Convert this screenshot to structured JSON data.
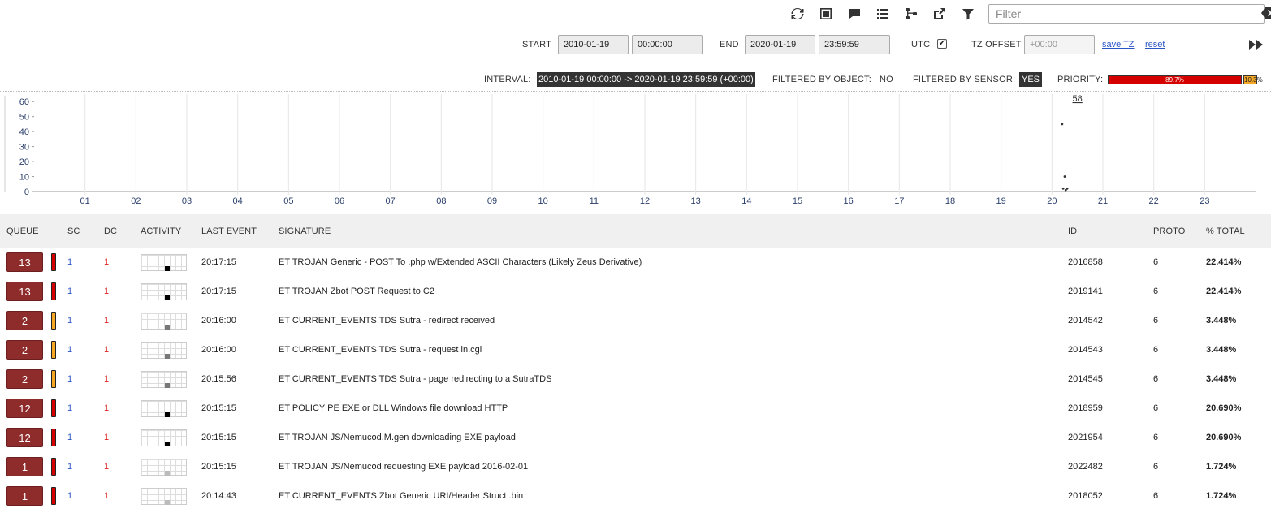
{
  "toolbar": {
    "icons": [
      "refresh-icon",
      "fullscreen-icon",
      "comment-icon",
      "list-icon",
      "tree-icon",
      "external-link-icon",
      "funnel-icon"
    ],
    "filter_placeholder": "Filter"
  },
  "timebar": {
    "start_label": "START",
    "start_date": "2010-01-19",
    "start_time": "00:00:00",
    "end_label": "END",
    "end_date": "2020-01-19",
    "end_time": "23:59:59",
    "utc_label": "UTC",
    "utc_checked": "✔",
    "tz_label": "TZ OFFSET",
    "tz_placeholder": "+00:00",
    "save_tz": "save TZ",
    "reset": "reset"
  },
  "status": {
    "interval_label": "INTERVAL:",
    "interval_value": "2010-01-19 00:00:00 -> 2020-01-19 23:59:59 (+00:00)",
    "filtered_object_label": "FILTERED BY OBJECT:",
    "filtered_object_value": "NO",
    "filtered_sensor_label": "FILTERED BY SENSOR:",
    "filtered_sensor_value": "YES",
    "priority_label": "PRIORITY:",
    "priority_high": "89.7%",
    "priority_med": "10.3%",
    "priority_high_fraction": 0.897,
    "priority_high_color": "#d40000",
    "priority_med_color": "#f5a623"
  },
  "chart_data": {
    "type": "scatter",
    "peak_label": "58",
    "y_ticks": [
      "60",
      "50",
      "40",
      "30",
      "20",
      "10",
      "0"
    ],
    "ylim": [
      0,
      65
    ],
    "x_ticks": [
      "01",
      "02",
      "03",
      "04",
      "05",
      "06",
      "07",
      "08",
      "09",
      "10",
      "11",
      "12",
      "13",
      "14",
      "15",
      "16",
      "17",
      "18",
      "19",
      "20",
      "21",
      "22",
      "23"
    ],
    "xlim": [
      0,
      24
    ],
    "points": [
      {
        "x": 20.2,
        "y": 45
      },
      {
        "x": 20.25,
        "y": 10
      },
      {
        "x": 20.22,
        "y": 2
      },
      {
        "x": 20.27,
        "y": 1
      },
      {
        "x": 20.3,
        "y": 2
      }
    ]
  },
  "table": {
    "headers": {
      "queue": "QUEUE",
      "sc": "SC",
      "dc": "DC",
      "activity": "ACTIVITY",
      "last_event": "LAST EVENT",
      "signature": "SIGNATURE",
      "id": "ID",
      "proto": "PROTO",
      "total": "% TOTAL"
    },
    "rows": [
      {
        "queue": "13",
        "prio": "#d40000",
        "sc": "1",
        "dc": "1",
        "act": "#000",
        "last": "20:17:15",
        "sig": "ET TROJAN Generic - POST To .php w/Extended ASCII Characters (Likely Zeus Derivative)",
        "id": "2016858",
        "proto": "6",
        "total": "22.414%"
      },
      {
        "queue": "13",
        "prio": "#d40000",
        "sc": "1",
        "dc": "1",
        "act": "#000",
        "last": "20:17:15",
        "sig": "ET TROJAN Zbot POST Request to C2",
        "id": "2019141",
        "proto": "6",
        "total": "22.414%"
      },
      {
        "queue": "2",
        "prio": "#f5a623",
        "sc": "1",
        "dc": "1",
        "act": "#777",
        "last": "20:16:00",
        "sig": "ET CURRENT_EVENTS TDS Sutra - redirect received",
        "id": "2014542",
        "proto": "6",
        "total": "3.448%"
      },
      {
        "queue": "2",
        "prio": "#f5a623",
        "sc": "1",
        "dc": "1",
        "act": "#777",
        "last": "20:16:00",
        "sig": "ET CURRENT_EVENTS TDS Sutra - request in.cgi",
        "id": "2014543",
        "proto": "6",
        "total": "3.448%"
      },
      {
        "queue": "2",
        "prio": "#f5a623",
        "sc": "1",
        "dc": "1",
        "act": "#777",
        "last": "20:15:56",
        "sig": "ET CURRENT_EVENTS TDS Sutra - page redirecting to a SutraTDS",
        "id": "2014545",
        "proto": "6",
        "total": "3.448%"
      },
      {
        "queue": "12",
        "prio": "#d40000",
        "sc": "1",
        "dc": "1",
        "act": "#000",
        "last": "20:15:15",
        "sig": "ET POLICY PE EXE or DLL Windows file download HTTP",
        "id": "2018959",
        "proto": "6",
        "total": "20.690%"
      },
      {
        "queue": "12",
        "prio": "#d40000",
        "sc": "1",
        "dc": "1",
        "act": "#000",
        "last": "20:15:15",
        "sig": "ET TROJAN JS/Nemucod.M.gen downloading EXE payload",
        "id": "2021954",
        "proto": "6",
        "total": "20.690%"
      },
      {
        "queue": "1",
        "prio": "#d40000",
        "sc": "1",
        "dc": "1",
        "act": "#bbb",
        "last": "20:15:15",
        "sig": "ET TROJAN JS/Nemucod requesting EXE payload 2016-02-01",
        "id": "2022482",
        "proto": "6",
        "total": "1.724%"
      },
      {
        "queue": "1",
        "prio": "#d40000",
        "sc": "1",
        "dc": "1",
        "act": "#bbb",
        "last": "20:14:43",
        "sig": "ET CURRENT_EVENTS Zbot Generic URI/Header Struct .bin",
        "id": "2018052",
        "proto": "6",
        "total": "1.724%"
      }
    ]
  }
}
